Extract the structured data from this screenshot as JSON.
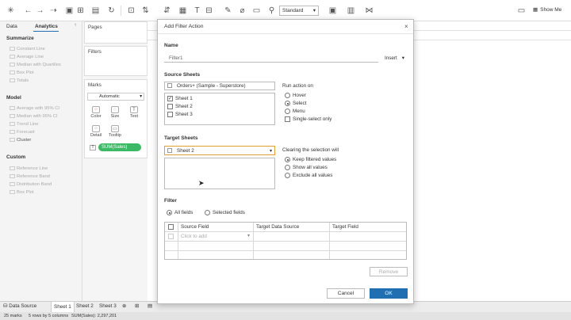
{
  "toolbar": {
    "fit_select": "Standard",
    "show_me": "Show Me"
  },
  "left_pane": {
    "tabs": [
      "Data",
      "Analytics"
    ],
    "summarize_heading": "Summarize",
    "summarize_items": [
      "Constant Line",
      "Average Line",
      "Median with Quartiles",
      "Box Plot",
      "Totals"
    ],
    "model_heading": "Model",
    "model_items": [
      "Average with 95% CI",
      "Median with 95% CI",
      "Trend Line",
      "Forecast",
      "Cluster"
    ],
    "custom_heading": "Custom",
    "custom_items": [
      "Reference Line",
      "Reference Band",
      "Distribution Band",
      "Box Plot"
    ]
  },
  "shelves": {
    "pages": "Pages",
    "filters": "Filters",
    "marks": "Marks",
    "mark_type": "Automatic",
    "mark_buttons": [
      "Color",
      "Size",
      "Text",
      "Detail",
      "Tooltip"
    ],
    "pill": "SUM(Sales)"
  },
  "bottom": {
    "data_source": "Data Source",
    "sheets": [
      "Sheet 1",
      "Sheet 2",
      "Sheet 3"
    ],
    "status_marks": "25 marks",
    "status_rows": "5 rows by 5 columns",
    "status_sum": "SUM(Sales): 2,297,201"
  },
  "dialog": {
    "title": "Add Filter Action",
    "close": "×",
    "name_label": "Name",
    "name_value": "Filter1",
    "insert_label": "Insert",
    "source_label": "Source Sheets",
    "source_datasource": "Orders+ (Sample - Superstore)",
    "source_sheets": [
      {
        "label": "Sheet 1",
        "checked": true
      },
      {
        "label": "Sheet 2",
        "checked": false
      },
      {
        "label": "Sheet 3",
        "checked": false
      }
    ],
    "run_action_label": "Run action on",
    "run_options": [
      {
        "label": "Hover",
        "selected": false
      },
      {
        "label": "Select",
        "selected": true
      },
      {
        "label": "Menu",
        "selected": false
      }
    ],
    "single_select": "Single-select only",
    "target_label": "Target Sheets",
    "target_value": "Sheet 2",
    "clearing_label": "Clearing the selection will",
    "clearing_options": [
      {
        "label": "Keep filtered values",
        "selected": true
      },
      {
        "label": "Show all values",
        "selected": false
      },
      {
        "label": "Exclude all values",
        "selected": false
      }
    ],
    "filter_label": "Filter",
    "filter_options": [
      {
        "label": "All fields",
        "selected": true
      },
      {
        "label": "Selected fields",
        "selected": false
      }
    ],
    "table_headers": [
      "Source Field",
      "Target Data Source",
      "Target Field"
    ],
    "click_to_add": "Click to add",
    "remove_button": "Remove",
    "cancel_button": "Cancel",
    "ok_button": "OK"
  }
}
